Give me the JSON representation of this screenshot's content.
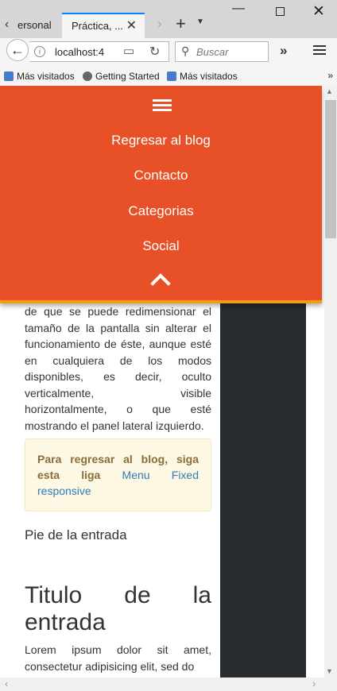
{
  "browser": {
    "tabs": [
      {
        "label": "ersonal"
      },
      {
        "label": "Práctica, ..."
      }
    ],
    "url": "localhost:4",
    "search_placeholder": "Buscar",
    "bookmarks": [
      "Más visitados",
      "Getting Started",
      "Más visitados"
    ],
    "bookmarks_more": "»"
  },
  "overlay_menu": {
    "items": [
      "Regresar al blog",
      "Contacto",
      "Categorias",
      "Social"
    ]
  },
  "article": {
    "paragraph": "de que se puede redimensionar el tamaño de la pantalla sin alterar el funcionamiento de éste, aunque esté en cualquiera de los modos disponibles, es decir, oculto verticalmente, visible horizontalmente, o que esté mostrando el panel lateral izquierdo.",
    "alert_bold": "Para regresar al blog, siga esta liga",
    "alert_link": "Menu Fixed responsive",
    "footer": "Pie de la entrada",
    "title": "Titulo de la entrada",
    "lorem": "Lorem ipsum dolor sit amet, consectetur adipisicing elit, sed do"
  },
  "colors": {
    "overlay_bg": "#e85127",
    "overlay_border": "#f39c12",
    "sidebar_bg": "#282c31",
    "alert_bg": "#fcf8e3",
    "link": "#337ab7"
  }
}
